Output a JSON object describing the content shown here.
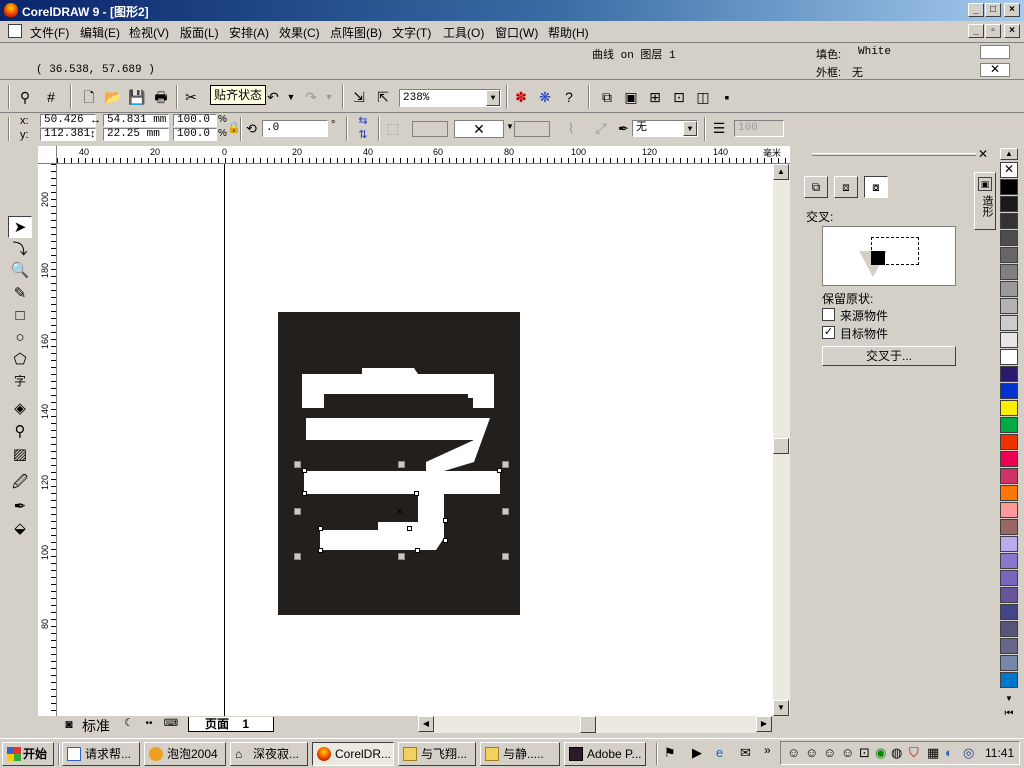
{
  "window": {
    "title": "CorelDRAW 9 - [图形2]"
  },
  "menu": [
    "文件(F)",
    "编辑(E)",
    "检视(V)",
    "版面(L)",
    "安排(A)",
    "效果(C)",
    "点阵图(B)",
    "文字(T)",
    "工具(O)",
    "窗口(W)",
    "帮助(H)"
  ],
  "status": {
    "coords": "( 36.538, 57.689 )",
    "object_info": "曲线 on 图层 1",
    "fill_label": "填色:",
    "fill_value": "White",
    "outline_label": "外框:",
    "outline_value": "无"
  },
  "toolbar": {
    "tooltip": "贴齐状态",
    "zoom": "238%"
  },
  "propbar": {
    "x_label": "x:",
    "x_value": "50.426",
    "y_label": "y:",
    "y_value": "112.381",
    "width_value": "54.831 mm",
    "height_value": "22.25 mm",
    "scale_x": "100.0",
    "scale_y": "100.0",
    "pct": "%",
    "rotation": ".0",
    "deg": "°",
    "outline_width": "无",
    "extra_value": "100"
  },
  "rulers": {
    "h_labels": [
      "40",
      "20",
      "0",
      "20",
      "40",
      "60",
      "80",
      "100",
      "120",
      "140"
    ],
    "h_unit": "毫米",
    "v_labels": [
      "200",
      "180",
      "160",
      "140",
      "120",
      "100",
      "80"
    ]
  },
  "canvas": {
    "character": "字"
  },
  "page_tabs": {
    "label": "标准",
    "page": "页面",
    "page_num": "1"
  },
  "docker": {
    "section": "交叉:",
    "keep_original": "保留原状:",
    "source_object": "来源物件",
    "target_object": "目标物件",
    "source_checked": false,
    "target_checked": true,
    "intersect_button": "交叉于...",
    "tab_label": "造形"
  },
  "palette": [
    "none",
    "#000000",
    "#1a1a1a",
    "#333333",
    "#4d4d4d",
    "#666666",
    "#808080",
    "#999999",
    "#b3b3b3",
    "#cccccc",
    "#e6e6e6",
    "#ffffff",
    "#2b1a6e",
    "#0033cc",
    "#ffee00",
    "#00aa44",
    "#ee3300",
    "#ee0055",
    "#cc3366",
    "#ff7700",
    "#ff9999",
    "#996666",
    "#bbaaee",
    "#8877cc",
    "#7766bb",
    "#665599",
    "#444488",
    "#555577",
    "#666688",
    "#7788aa",
    "#0077cc"
  ],
  "taskbar": {
    "start": "开始",
    "tasks": [
      "请求帮...",
      "泡泡2004",
      "深夜寂...",
      "CorelDR...",
      "与飞翔...",
      "与静.....",
      "Adobe P..."
    ],
    "clock": "11:41"
  }
}
